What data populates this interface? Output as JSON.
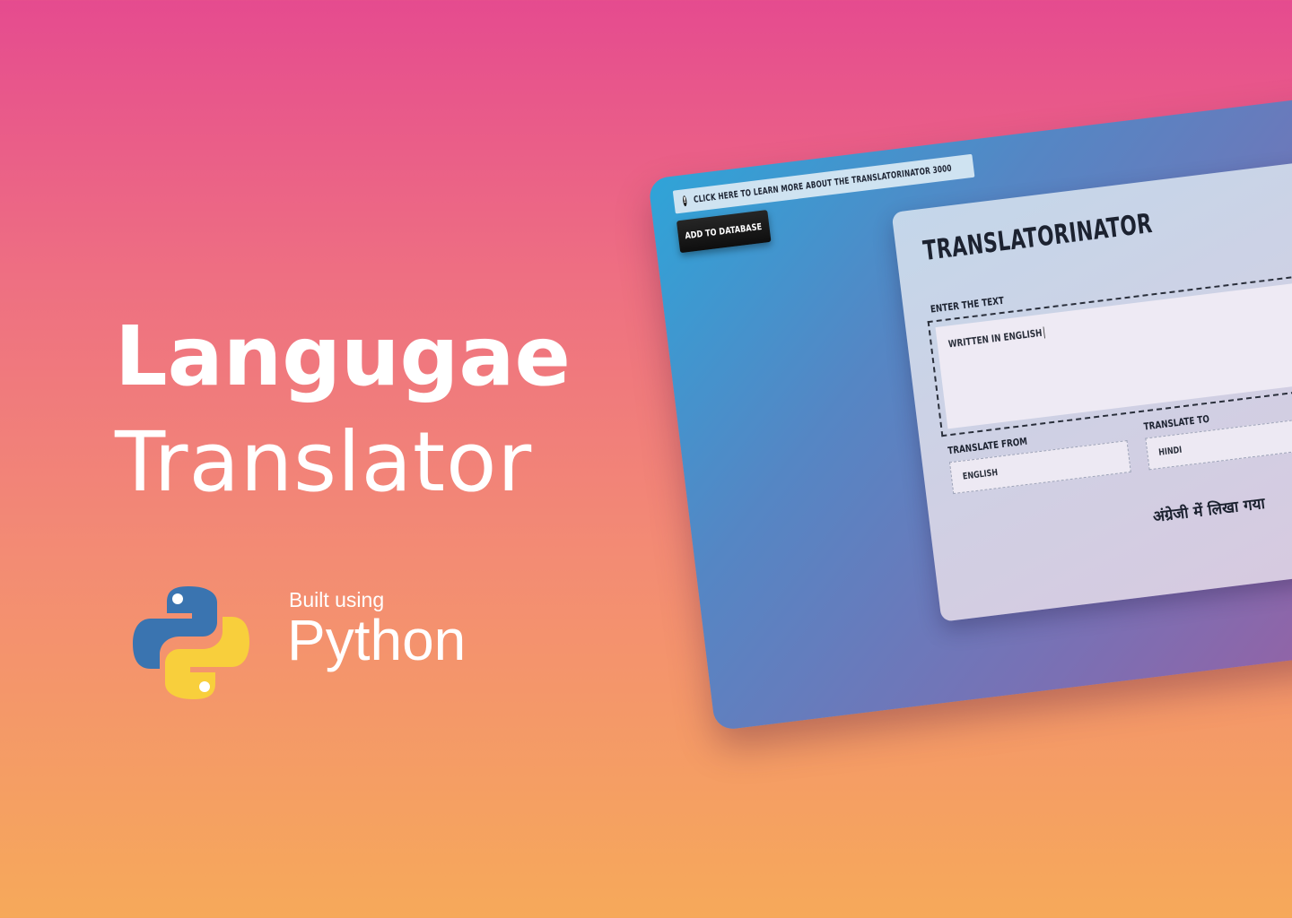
{
  "hero": {
    "title_bold": "Langugae",
    "title_light": "Translator",
    "built_using": "Built using",
    "language": "Python",
    "logo_icon": "python-logo-icon"
  },
  "app": {
    "info_banner": "CLICK HERE TO LEARN MORE ABOUT THE TRANSLATORINATOR 3000",
    "info_icon": "exclamation-circle-icon",
    "add_button": "ADD TO DATABASE",
    "title": "TRANSLATORINATOR",
    "enter_label": "ENTER THE TEXT",
    "input_value": "WRITTEN IN ENGLISH",
    "from_label": "TRANSLATE FROM",
    "from_value": "ENGLISH",
    "to_label": "TRANSLATE TO",
    "to_value": "HINDI",
    "output": "अंग्रेजी में लिखा गया"
  },
  "colors": {
    "bg_top": "#e54b8f",
    "bg_bottom": "#f6a95a",
    "python_blue": "#3a74b0",
    "python_yellow": "#f8cf3c"
  }
}
